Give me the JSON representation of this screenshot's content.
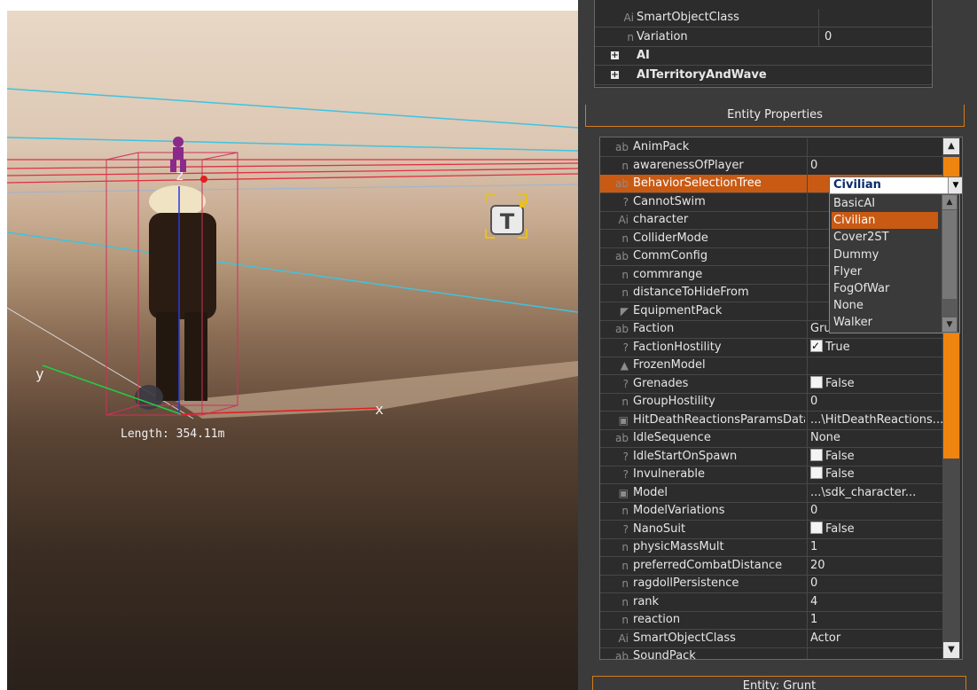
{
  "viewport": {
    "axis_x": "x",
    "axis_y": "y",
    "axis_z": "z",
    "length_label": "Length: 354.11m",
    "tag_icon_letter": "T"
  },
  "top_group": {
    "rows": [
      {
        "icon": "Ai",
        "name": "SmartObjectClass",
        "value": ""
      },
      {
        "icon": "n",
        "name": "Variation",
        "value": "0"
      }
    ],
    "groups": [
      {
        "name": "AI"
      },
      {
        "name": "AITerritoryAndWave"
      }
    ]
  },
  "entity_properties": {
    "header": "Entity Properties",
    "rows": [
      {
        "icon": "ab",
        "name": "AnimPack",
        "value": ""
      },
      {
        "icon": "n",
        "name": "awarenessOfPlayer",
        "value": "0"
      },
      {
        "icon": "ab",
        "name": "BehaviorSelectionTree",
        "value": ""
      },
      {
        "icon": "?",
        "name": "CannotSwim",
        "value": ""
      },
      {
        "icon": "Ai",
        "name": "character",
        "value": ""
      },
      {
        "icon": "n",
        "name": "ColliderMode",
        "value": ""
      },
      {
        "icon": "ab",
        "name": "CommConfig",
        "value": ""
      },
      {
        "icon": "n",
        "name": "commrange",
        "value": ""
      },
      {
        "icon": "n",
        "name": "distanceToHideFrom",
        "value": ""
      },
      {
        "icon": "gun",
        "name": "EquipmentPack",
        "value": ""
      },
      {
        "icon": "ab",
        "name": "Faction",
        "value": "Grunts"
      },
      {
        "icon": "?",
        "name": "FactionHostility",
        "value": "True",
        "checkbox": true,
        "checked": true
      },
      {
        "icon": "tri",
        "name": "FrozenModel",
        "value": ""
      },
      {
        "icon": "?",
        "name": "Grenades",
        "value": "False",
        "checkbox": true,
        "checked": false
      },
      {
        "icon": "n",
        "name": "GroupHostility",
        "value": "0"
      },
      {
        "icon": "disk",
        "name": "HitDeathReactionsParamsDataFile",
        "value": "...\\HitDeathReactions..."
      },
      {
        "icon": "ab",
        "name": "IdleSequence",
        "value": "None"
      },
      {
        "icon": "?",
        "name": "IdleStartOnSpawn",
        "value": "False",
        "checkbox": true,
        "checked": false
      },
      {
        "icon": "?",
        "name": "Invulnerable",
        "value": "False",
        "checkbox": true,
        "checked": false
      },
      {
        "icon": "disk",
        "name": "Model",
        "value": "...\\sdk_character..."
      },
      {
        "icon": "n",
        "name": "ModelVariations",
        "value": "0"
      },
      {
        "icon": "?",
        "name": "NanoSuit",
        "value": "False",
        "checkbox": true,
        "checked": false
      },
      {
        "icon": "n",
        "name": "physicMassMult",
        "value": "1"
      },
      {
        "icon": "n",
        "name": "preferredCombatDistance",
        "value": "20"
      },
      {
        "icon": "n",
        "name": "ragdollPersistence",
        "value": "0"
      },
      {
        "icon": "n",
        "name": "rank",
        "value": "4"
      },
      {
        "icon": "n",
        "name": "reaction",
        "value": "1"
      },
      {
        "icon": "Ai",
        "name": "SmartObjectClass",
        "value": "Actor"
      },
      {
        "icon": "ab",
        "name": "SoundPack",
        "value": ""
      }
    ],
    "selected_row": "BehaviorSelectionTree",
    "combo": {
      "value": "Civilian",
      "options": [
        "BasicAI",
        "Civilian",
        "Cover2ST",
        "Dummy",
        "Flyer",
        "FogOfWar",
        "None",
        "Walker"
      ],
      "highlighted": "Civilian"
    }
  },
  "bottom_header": "Entity: Grunt",
  "colors": {
    "accent_orange": "#f08410",
    "selection": "#c85a14",
    "panel_bg": "#2c2c2c"
  }
}
